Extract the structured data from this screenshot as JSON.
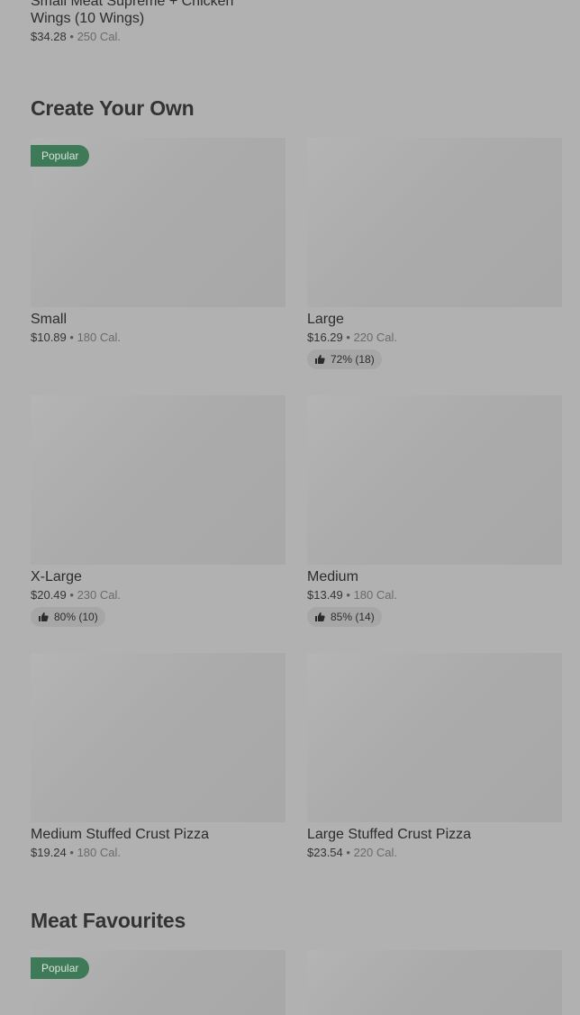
{
  "top_item": {
    "title": "Small Meat Supreme + Chicken Wings (10 Wings)",
    "price": "$34.28",
    "separator": "•",
    "calories": "250 Cal."
  },
  "sections": [
    {
      "title": "Create Your Own",
      "items": [
        {
          "badge": "Popular",
          "title": "Small",
          "price": "$10.89",
          "calories": "180 Cal."
        },
        {
          "title": "Large",
          "price": "$16.29",
          "calories": "220 Cal.",
          "rating": "72% (18)"
        },
        {
          "title": "X-Large",
          "price": "$20.49",
          "calories": "230 Cal.",
          "rating": "80% (10)"
        },
        {
          "title": "Medium",
          "price": "$13.49",
          "calories": "180 Cal.",
          "rating": "85% (14)"
        },
        {
          "title": "Medium Stuffed Crust Pizza",
          "price": "$19.24",
          "calories": "180 Cal."
        },
        {
          "title": "Large Stuffed Crust Pizza",
          "price": "$23.54",
          "calories": "220 Cal."
        }
      ]
    },
    {
      "title": "Meat Favourites",
      "items": [
        {
          "badge": "Popular"
        },
        {}
      ]
    }
  ],
  "separator": "•",
  "icons": {
    "rating": "thumbs-up-icon"
  }
}
